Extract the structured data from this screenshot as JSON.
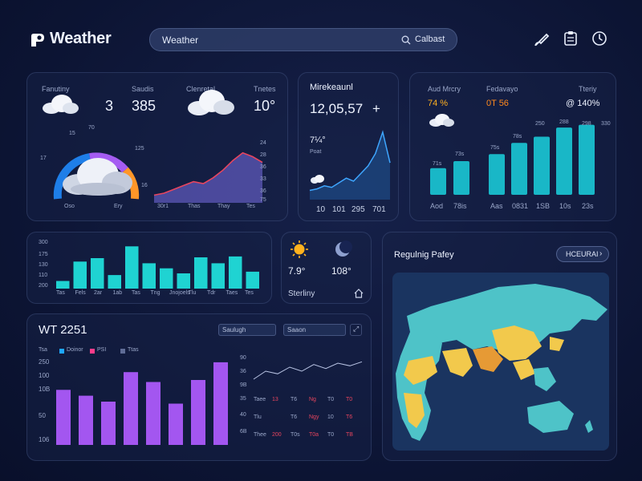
{
  "app": {
    "title": "Weather"
  },
  "search": {
    "text": "Weather",
    "button_label": "Calbast"
  },
  "panel_weather": {
    "labels": [
      "Fanutiny",
      "Saudis",
      "Clenretal",
      "Tnetes"
    ],
    "values": [
      "3",
      "385",
      "10°"
    ],
    "gauge_ticks": [
      "70",
      "17",
      "125",
      "16",
      "15"
    ],
    "gauge_bottom": [
      "Oso",
      "Ery"
    ],
    "area_x": [
      "30r1",
      "Thas",
      "Thay",
      "Tes"
    ],
    "area_y": [
      "24",
      "28",
      "36",
      "33",
      "36",
      "75"
    ],
    "area_values": [
      4,
      5,
      7,
      9,
      11,
      10,
      13,
      17,
      22,
      26,
      24,
      21
    ]
  },
  "panel_market": {
    "title": "Mirekeaunl",
    "value": "12,05,57",
    "plus": "+",
    "sub_value": "7¼°",
    "sub_label": "Poat",
    "x_labels": [
      "10",
      "101",
      "295",
      "701"
    ],
    "line_values": [
      6,
      7,
      9,
      8,
      11,
      14,
      12,
      17,
      22,
      30,
      44,
      24
    ]
  },
  "panel_humidity": {
    "labels": [
      "Aud Mrcry",
      "Fedavayo",
      "Tteriy"
    ],
    "values": [
      "74 %",
      "0T 56",
      "@ 140%"
    ],
    "value_colors": [
      "#ffb020",
      "#ff8a1e",
      "#eef3ff"
    ],
    "bars": [
      {
        "value": 38,
        "label": ""
      },
      {
        "value": 48,
        "label": ""
      },
      {
        "value": 58,
        "label": ""
      },
      {
        "value": 74,
        "label": "Aod"
      },
      {
        "value": 83,
        "label": "Aod"
      },
      {
        "value": 96,
        "label": "Tl5"
      },
      {
        "value": 100,
        "label": "7B0"
      }
    ],
    "x_labels": [
      "Aod",
      "78is",
      "Aas",
      "0831",
      "1SB",
      "10s",
      "23s"
    ],
    "bar_top_labels": [
      "71s",
      "73s",
      "75s",
      "78s",
      "250",
      "288",
      "298",
      "330"
    ]
  },
  "panel_bars": {
    "y_labels": [
      "300",
      "175",
      "130",
      "110",
      "200"
    ],
    "values": [
      9,
      32,
      36,
      16,
      50,
      30,
      24,
      18,
      37,
      30,
      38,
      20
    ],
    "x_labels": [
      "Tas",
      "Fels",
      "2ar",
      "1ab",
      "Tas",
      "Tng",
      "Jnojoels",
      "Tlu",
      "Tdr",
      "Taes",
      "Tes"
    ]
  },
  "panel_sun": {
    "temp1": "7.9°",
    "temp2": "108°",
    "footer_label": "Sterliny"
  },
  "panel_map": {
    "title": "Regulnig Pafey",
    "button_label": "HCEURAI"
  },
  "panel_bottom": {
    "title": "WT 2251",
    "button1": "Saulugh",
    "button2": "Saaon",
    "legend": [
      {
        "label": "Doinor",
        "color": "#1ea7ff"
      },
      {
        "label": "PSI",
        "color": "#ff3d8b"
      },
      {
        "label": "Ttas",
        "color": "#5f6c96"
      }
    ],
    "left_label": "Tsa",
    "y_labels": [
      "250",
      "100",
      "10B",
      "50",
      "106"
    ],
    "bar_values": [
      140,
      125,
      110,
      185,
      160,
      105,
      165,
      210
    ],
    "right_y": [
      "90",
      "36",
      "9B",
      "35",
      "40",
      "6B"
    ],
    "line_values": [
      18,
      30,
      26,
      36,
      30,
      40,
      34,
      42,
      38,
      44
    ],
    "table_rows": [
      [
        "Taee",
        "13",
        "T6",
        "Ng",
        "T0",
        "T0"
      ],
      [
        "Tlu",
        "",
        "T6",
        "Ngy",
        "10",
        "T6"
      ],
      [
        "Thee",
        "200",
        "T0s",
        "T0a",
        "T0",
        "TB"
      ]
    ]
  },
  "header_icons": [
    "brush-icon",
    "clipboard-icon",
    "clock-icon"
  ]
}
